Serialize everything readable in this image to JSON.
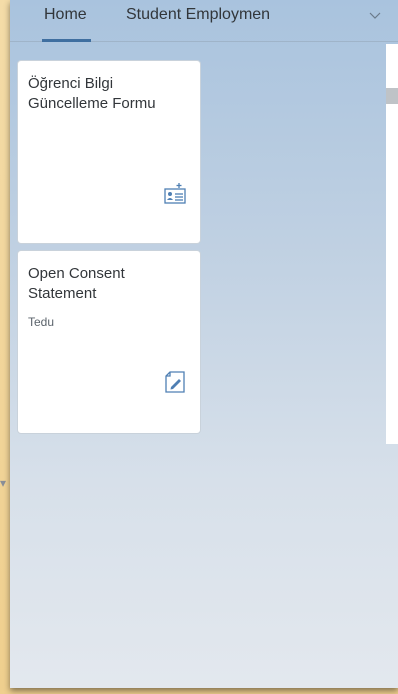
{
  "tabs": [
    {
      "label": "Home",
      "selected": true
    },
    {
      "label": "Student Employmen",
      "selected": false
    }
  ],
  "tabs_overflow_icon": "chevron-down-icon",
  "tiles": [
    {
      "title": "Öğrenci Bilgi Güncelleme Formu",
      "subtitle": "",
      "icon": "add-contact-icon"
    },
    {
      "title": "Open Consent Statement",
      "subtitle": "Tedu",
      "icon": "edit-document-icon"
    }
  ],
  "colors": {
    "accent": "#3f6fa0",
    "icon": "#4f7fb3",
    "tile_text": "#32363a",
    "background_warm": "#efcf8e"
  }
}
